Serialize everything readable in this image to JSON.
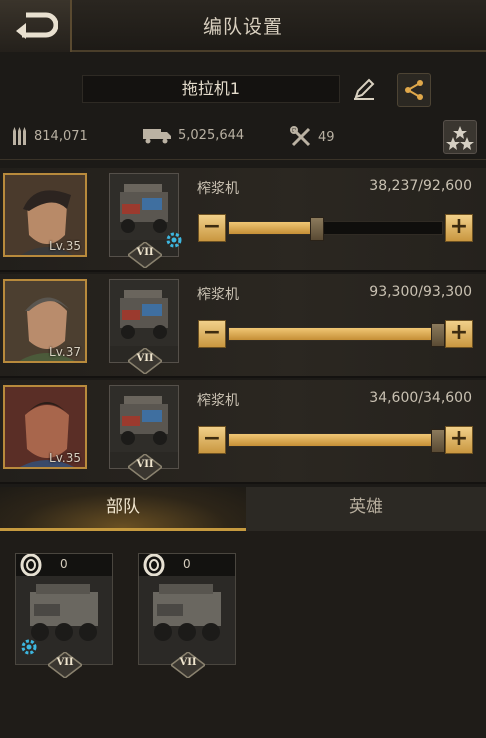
{
  "header": {
    "title": "编队设置"
  },
  "formation": {
    "name": "拖拉机1"
  },
  "stats": {
    "ammo": "814,071",
    "load": "5,025,644",
    "repair": "49"
  },
  "slots": [
    {
      "hero_level": "Lv.35",
      "unit_name": "榨浆机",
      "count": "38,237/92,600",
      "fill_fraction": 0.413,
      "rank": "VII",
      "has_gear": true
    },
    {
      "hero_level": "Lv.37",
      "unit_name": "榨浆机",
      "count": "93,300/93,300",
      "fill_fraction": 1.0,
      "rank": "VII",
      "has_gear": false
    },
    {
      "hero_level": "Lv.35",
      "unit_name": "榨浆机",
      "count": "34,600/34,600",
      "fill_fraction": 1.0,
      "rank": "VII",
      "has_gear": false
    }
  ],
  "slider_buttons": {
    "minus": "−",
    "plus": "+"
  },
  "tabs": [
    {
      "label": "部队",
      "active": true
    },
    {
      "label": "英雄",
      "active": false
    }
  ],
  "available_units": [
    {
      "count": "0",
      "rank": "VII",
      "has_gear": true
    },
    {
      "count": "0",
      "rank": "VII",
      "has_gear": false
    }
  ],
  "colors": {
    "accent_gold": "#c69a3f",
    "gear_blue": "#3db7e0"
  },
  "icons": {
    "back": "back-arrow-icon",
    "edit": "pencil-icon",
    "share": "share-icon",
    "ammo": "bullets-icon",
    "load": "truck-icon",
    "repair": "tools-icon",
    "rank": "stars-icon",
    "tire": "tire-icon",
    "gear": "gear-icon"
  }
}
